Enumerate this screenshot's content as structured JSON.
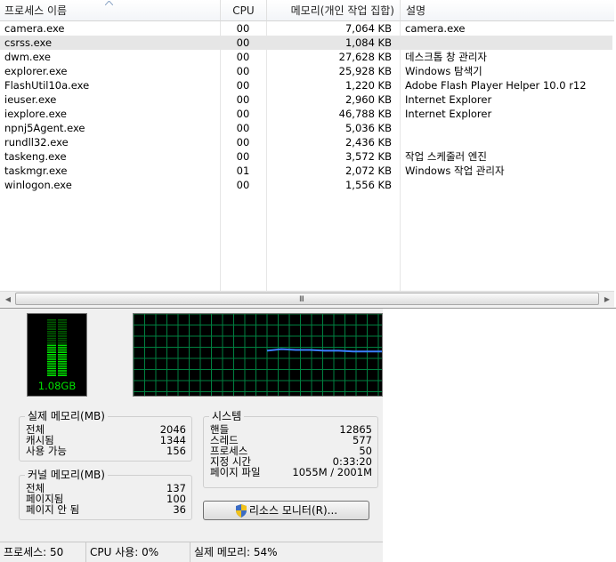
{
  "process_table": {
    "columns": {
      "name": "프로세스 이름",
      "cpu": "CPU",
      "memory": "메모리(개인 작업 집합)",
      "description": "설명"
    },
    "rows": [
      {
        "name": "camera.exe",
        "cpu": "00",
        "memory": "7,064 KB",
        "description": "camera.exe",
        "selected": false
      },
      {
        "name": "csrss.exe",
        "cpu": "00",
        "memory": "1,084 KB",
        "description": "",
        "selected": true
      },
      {
        "name": "dwm.exe",
        "cpu": "00",
        "memory": "27,628 KB",
        "description": "데스크톱 창 관리자",
        "selected": false
      },
      {
        "name": "explorer.exe",
        "cpu": "00",
        "memory": "25,928 KB",
        "description": "Windows 탐색기",
        "selected": false
      },
      {
        "name": "FlashUtil10a.exe",
        "cpu": "00",
        "memory": "1,220 KB",
        "description": "Adobe Flash Player Helper 10.0 r12",
        "selected": false
      },
      {
        "name": "ieuser.exe",
        "cpu": "00",
        "memory": "2,960 KB",
        "description": "Internet Explorer",
        "selected": false
      },
      {
        "name": "iexplore.exe",
        "cpu": "00",
        "memory": "46,788 KB",
        "description": "Internet Explorer",
        "selected": false
      },
      {
        "name": "npnj5Agent.exe",
        "cpu": "00",
        "memory": "5,036 KB",
        "description": "",
        "selected": false
      },
      {
        "name": "rundll32.exe",
        "cpu": "00",
        "memory": "2,436 KB",
        "description": "",
        "selected": false
      },
      {
        "name": "taskeng.exe",
        "cpu": "00",
        "memory": "3,572 KB",
        "description": "작업 스케줄러 엔진",
        "selected": false
      },
      {
        "name": "taskmgr.exe",
        "cpu": "01",
        "memory": "2,072 KB",
        "description": "Windows 작업 관리자",
        "selected": false
      },
      {
        "name": "winlogon.exe",
        "cpu": "00",
        "memory": "1,556 KB",
        "description": "",
        "selected": false
      }
    ],
    "scrollbar": {
      "grip": "III"
    }
  },
  "performance": {
    "memory_gauge": {
      "label": "1.08GB",
      "used_fraction": 0.54,
      "color": "#00e000"
    },
    "memory_history": {
      "color": "#3a7fff",
      "grid_color": "#008040",
      "values": [
        0.55,
        0.57,
        0.56,
        0.56,
        0.55,
        0.55,
        0.54,
        0.54,
        0.54
      ]
    },
    "physical_memory": {
      "title": "실제 메모리(MB)",
      "rows": [
        {
          "label": "전체",
          "value": "2046"
        },
        {
          "label": "캐시됨",
          "value": "1344"
        },
        {
          "label": "사용 가능",
          "value": "156"
        }
      ]
    },
    "kernel_memory": {
      "title": "커널 메모리(MB)",
      "rows": [
        {
          "label": "전체",
          "value": "137"
        },
        {
          "label": "페이지됨",
          "value": "100"
        },
        {
          "label": "페이지 안 됨",
          "value": "36"
        }
      ]
    },
    "system": {
      "title": "시스템",
      "rows": [
        {
          "label": "핸들",
          "value": "12865"
        },
        {
          "label": "스레드",
          "value": "577"
        },
        {
          "label": "프로세스",
          "value": "50"
        },
        {
          "label": "지정 시간",
          "value": "0:33:20"
        },
        {
          "label": "페이지 파일",
          "value": "1055M / 2001M"
        }
      ]
    },
    "resource_monitor_button": "리소스 모니터(R)..."
  },
  "status_bar": {
    "processes": "프로세스: 50",
    "cpu_usage": "CPU 사용: 0%",
    "physical_memory": "실제 메모리: 54%"
  }
}
